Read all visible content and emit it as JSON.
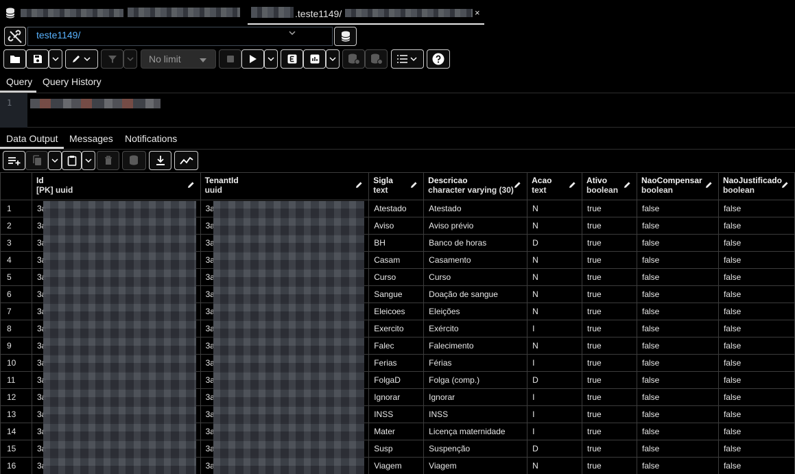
{
  "tab": {
    "title": ".teste1149/",
    "close": "×"
  },
  "connection": {
    "text": "teste1149/"
  },
  "toolbar": {
    "limit_label": "No limit"
  },
  "query_tabs": [
    "Query",
    "Query History"
  ],
  "editor": {
    "line_number": "1"
  },
  "output_tabs": [
    "Data Output",
    "Messages",
    "Notifications"
  ],
  "columns": [
    {
      "name": "Id",
      "type": "[PK] uuid"
    },
    {
      "name": "TenantId",
      "type": "uuid"
    },
    {
      "name": "Sigla",
      "type": "text"
    },
    {
      "name": "Descricao",
      "type": "character varying (30)"
    },
    {
      "name": "Acao",
      "type": "text"
    },
    {
      "name": "Ativo",
      "type": "boolean"
    },
    {
      "name": "NaoCompensar",
      "type": "boolean"
    },
    {
      "name": "NaoJustificado",
      "type": "boolean"
    }
  ],
  "rows": [
    {
      "n": "1",
      "id": "3a",
      "tenant": "3a",
      "sigla": "Atestado",
      "descricao": "Atestado",
      "acao": "N",
      "ativo": "true",
      "naocomp": "false",
      "naojust": "false"
    },
    {
      "n": "2",
      "id": "3a",
      "tenant": "3a",
      "sigla": "Aviso",
      "descricao": "Aviso prévio",
      "acao": "N",
      "ativo": "true",
      "naocomp": "false",
      "naojust": "false"
    },
    {
      "n": "3",
      "id": "3a",
      "tenant": "3a",
      "sigla": "BH",
      "descricao": "Banco de horas",
      "acao": "D",
      "ativo": "true",
      "naocomp": "false",
      "naojust": "false"
    },
    {
      "n": "4",
      "id": "3a",
      "tenant": "3a",
      "sigla": "Casam",
      "descricao": "Casamento",
      "acao": "N",
      "ativo": "true",
      "naocomp": "false",
      "naojust": "false"
    },
    {
      "n": "5",
      "id": "3a",
      "tenant": "3a",
      "sigla": "Curso",
      "descricao": "Curso",
      "acao": "N",
      "ativo": "true",
      "naocomp": "false",
      "naojust": "false"
    },
    {
      "n": "6",
      "id": "3a",
      "tenant": "3a",
      "sigla": "Sangue",
      "descricao": "Doação de sangue",
      "acao": "N",
      "ativo": "true",
      "naocomp": "false",
      "naojust": "false"
    },
    {
      "n": "7",
      "id": "3a",
      "tenant": "3a",
      "sigla": "Eleicoes",
      "descricao": "Eleições",
      "acao": "N",
      "ativo": "true",
      "naocomp": "false",
      "naojust": "false"
    },
    {
      "n": "8",
      "id": "3a",
      "tenant": "3a",
      "sigla": "Exercito",
      "descricao": "Exército",
      "acao": "I",
      "ativo": "true",
      "naocomp": "false",
      "naojust": "false"
    },
    {
      "n": "9",
      "id": "3a",
      "tenant": "3a",
      "sigla": "Falec",
      "descricao": "Falecimento",
      "acao": "N",
      "ativo": "true",
      "naocomp": "false",
      "naojust": "false"
    },
    {
      "n": "10",
      "id": "3a",
      "tenant": "3a",
      "sigla": "Ferias",
      "descricao": "Férias",
      "acao": "I",
      "ativo": "true",
      "naocomp": "false",
      "naojust": "false"
    },
    {
      "n": "11",
      "id": "3a",
      "tenant": "3a",
      "sigla": "FolgaD",
      "descricao": "Folga (comp.)",
      "acao": "D",
      "ativo": "true",
      "naocomp": "false",
      "naojust": "false"
    },
    {
      "n": "12",
      "id": "3a",
      "tenant": "3a",
      "sigla": "Ignorar",
      "descricao": "Ignorar",
      "acao": "I",
      "ativo": "true",
      "naocomp": "false",
      "naojust": "false"
    },
    {
      "n": "13",
      "id": "3a",
      "tenant": "3a",
      "sigla": "INSS",
      "descricao": "INSS",
      "acao": "I",
      "ativo": "true",
      "naocomp": "false",
      "naojust": "false"
    },
    {
      "n": "14",
      "id": "3a",
      "tenant": "3a",
      "sigla": "Mater",
      "descricao": "Licença maternidade",
      "acao": "I",
      "ativo": "true",
      "naocomp": "false",
      "naojust": "false"
    },
    {
      "n": "15",
      "id": "3a",
      "tenant": "3a",
      "sigla": "Susp",
      "descricao": "Suspenção",
      "acao": "D",
      "ativo": "true",
      "naocomp": "false",
      "naojust": "false"
    },
    {
      "n": "16",
      "id": "3a",
      "tenant": "3a",
      "sigla": "Viagem",
      "descricao": "Viagem",
      "acao": "N",
      "ativo": "true",
      "naocomp": "false",
      "naojust": "false"
    }
  ]
}
